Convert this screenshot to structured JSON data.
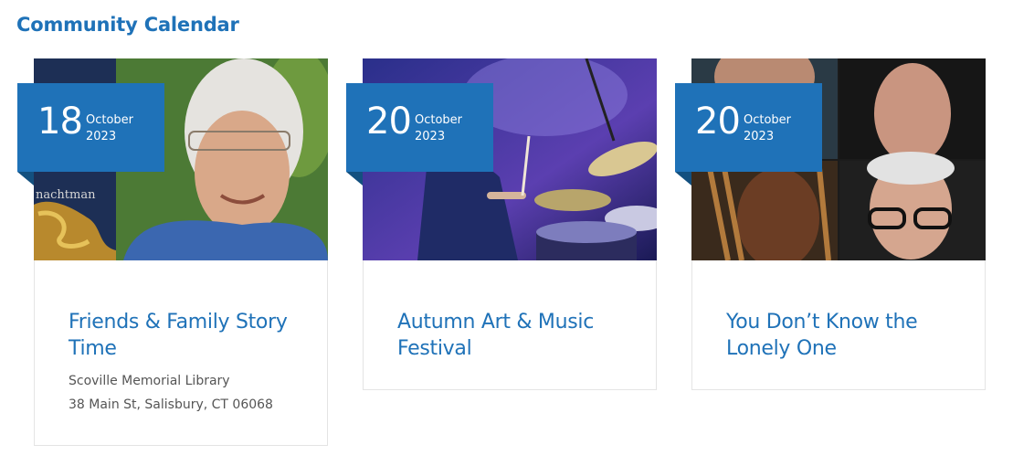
{
  "section_title": "Community Calendar",
  "accent_color": "#1f72b8",
  "events": [
    {
      "day": "18",
      "month": "October",
      "year": "2023",
      "title": "Friends & Family Story Time",
      "venue": "Scoville Memorial Library",
      "address": "38 Main St, Salisbury, CT 06068",
      "image_text": "nachtman"
    },
    {
      "day": "20",
      "month": "October",
      "year": "2023",
      "title": "Autumn Art & Music Festival"
    },
    {
      "day": "20",
      "month": "October",
      "year": "2023",
      "title": "You Don’t Know the Lonely One"
    }
  ]
}
